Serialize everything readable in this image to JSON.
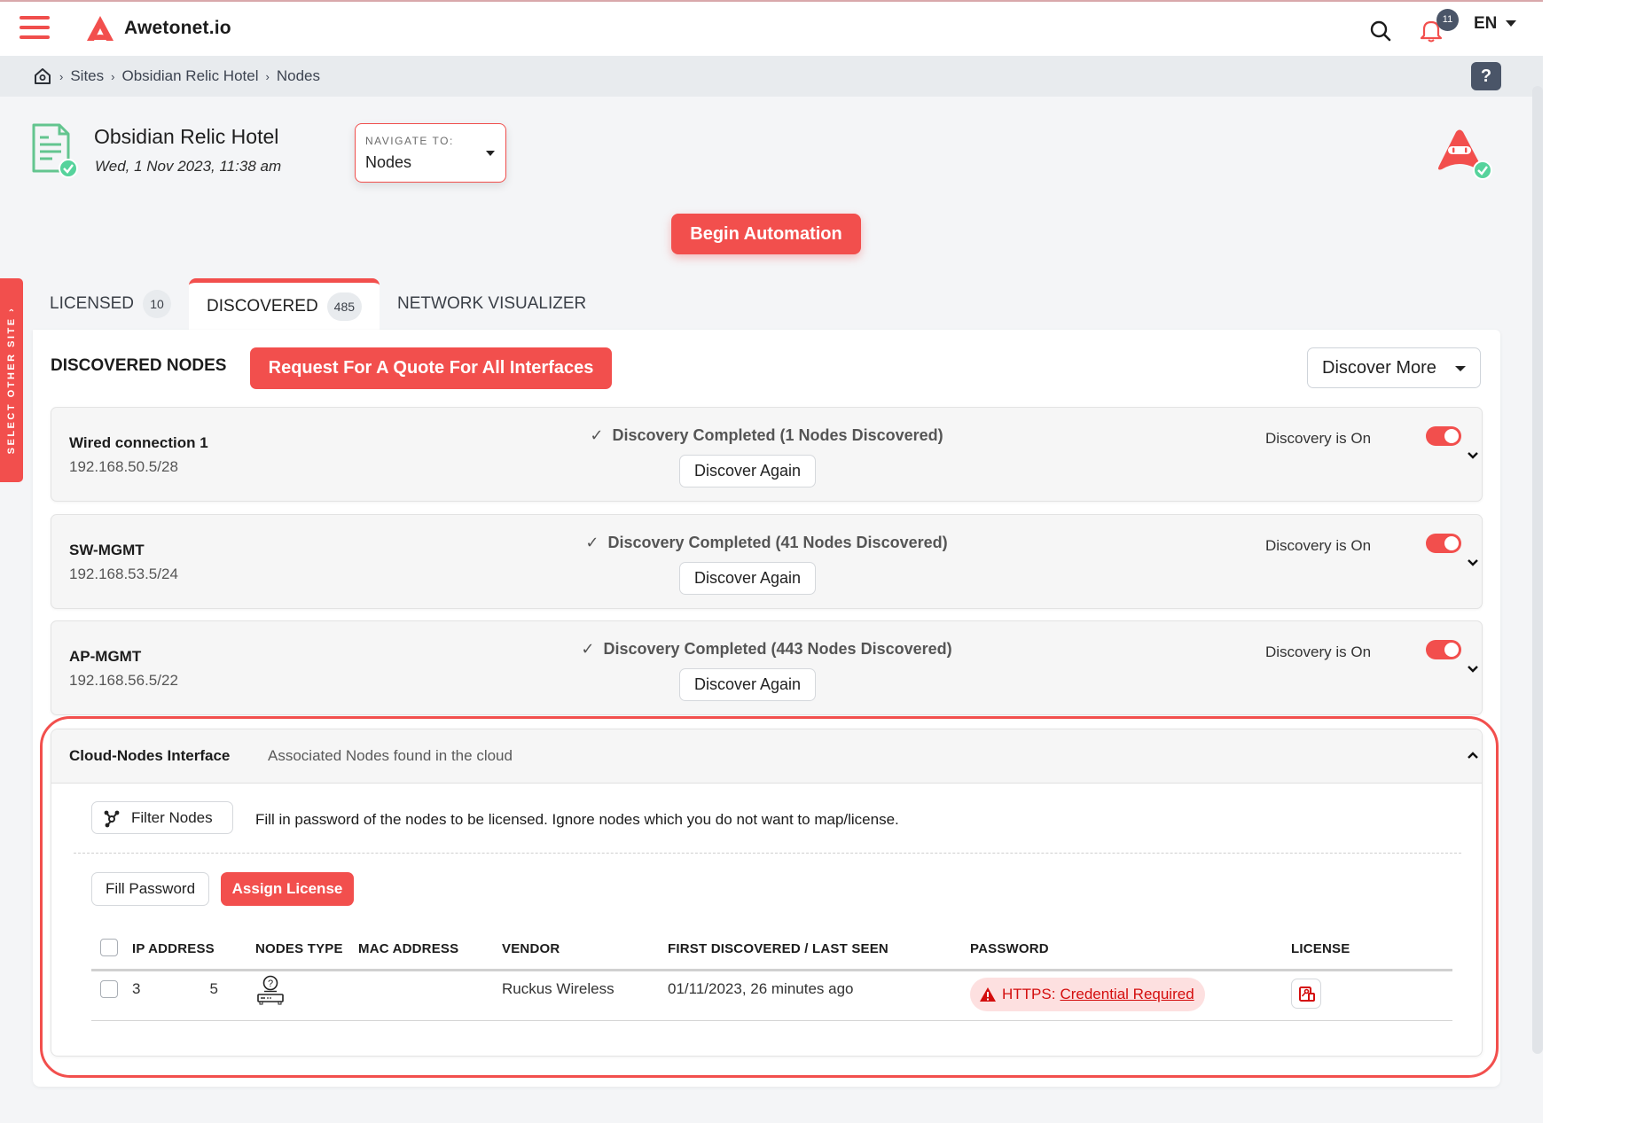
{
  "app": {
    "brand_name": "Awetonet.io",
    "notifications_count": "11",
    "language": "EN"
  },
  "breadcrumb": {
    "items": [
      "Sites",
      "Obsidian Relic Hotel",
      "Nodes"
    ]
  },
  "help_label": "?",
  "site": {
    "title": "Obsidian Relic Hotel",
    "date": "Wed, 1 Nov 2023, 11:38 am"
  },
  "navigate_to": {
    "label": "NAVIGATE TO:",
    "value": "Nodes"
  },
  "begin_automation_label": "Begin Automation",
  "side_tab_label": "SELECT OTHER SITE",
  "tabs": [
    {
      "label": "LICENSED",
      "count": "10",
      "active": false
    },
    {
      "label": "DISCOVERED",
      "count": "485",
      "active": true
    },
    {
      "label": "NETWORK VISUALIZER",
      "active": false
    }
  ],
  "discovered": {
    "title": "DISCOVERED NODES",
    "quote_button": "Request For A Quote For All Interfaces",
    "discover_more_button": "Discover More",
    "interfaces": [
      {
        "name": "Wired connection 1",
        "subnet": "192.168.50.5/28",
        "status": "Discovery Completed (1 Nodes Discovered)",
        "action": "Discover Again",
        "toggle_label": "Discovery is On",
        "toggle_on": true
      },
      {
        "name": "SW-MGMT",
        "subnet": "192.168.53.5/24",
        "status": "Discovery Completed (41 Nodes Discovered)",
        "action": "Discover Again",
        "toggle_label": "Discovery is On",
        "toggle_on": true
      },
      {
        "name": "AP-MGMT",
        "subnet": "192.168.56.5/22",
        "status": "Discovery Completed (443 Nodes Discovered)",
        "action": "Discover Again",
        "toggle_label": "Discovery is On",
        "toggle_on": true
      }
    ]
  },
  "cloud": {
    "title": "Cloud-Nodes Interface",
    "subtitle": "Associated Nodes found in the cloud",
    "filter_button": "Filter Nodes",
    "hint": "Fill in password of the nodes to be licensed. Ignore nodes which you do not want to map/license.",
    "fill_password_button": "Fill Password",
    "assign_license_button": "Assign License",
    "table": {
      "columns": [
        "IP ADDRESS",
        "NODES TYPE",
        "MAC ADDRESS",
        "VENDOR",
        "FIRST DISCOVERED / LAST SEEN",
        "PASSWORD",
        "LICENSE"
      ],
      "rows": [
        {
          "ip_start": "3",
          "ip_end": "5",
          "node_type_icon": "unknown-device-icon",
          "mac": "",
          "vendor": "Ruckus Wireless",
          "seen": "01/11/2023, 26 minutes ago",
          "password_prefix": "HTTPS:",
          "password_link": "Credential Required"
        }
      ]
    }
  },
  "colors": {
    "accent": "#f24f4d",
    "success": "#56d39c",
    "badge": "#4a5568",
    "error_text": "#d40d0d",
    "error_bg": "#fde0e0"
  }
}
